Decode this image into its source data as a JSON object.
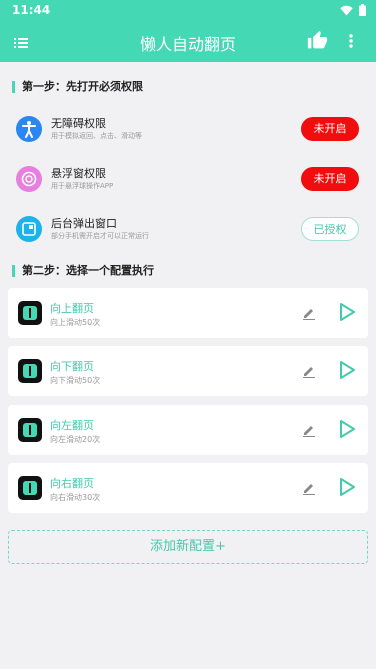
{
  "status": {
    "time": "11:44"
  },
  "appbar": {
    "title": "懒人自动翻页"
  },
  "step1": {
    "title": "第一步：先打开必须权限",
    "items": [
      {
        "title": "无障碍权限",
        "desc": "用于模拟返回、点击、滑动等",
        "button": "未开启",
        "icon": "accessibility-icon",
        "state": "off"
      },
      {
        "title": "悬浮窗权限",
        "desc": "用于悬浮球操作APP",
        "button": "未开启",
        "icon": "floating-window-icon",
        "state": "off"
      },
      {
        "title": "后台弹出窗口",
        "desc": "部分手机需开启才可以正常运行",
        "button": "已授权",
        "icon": "background-popup-icon",
        "state": "on"
      }
    ]
  },
  "step2": {
    "title": "第二步：选择一个配置执行",
    "configs": [
      {
        "title": "向上翻页",
        "desc": "向上滑动50次"
      },
      {
        "title": "向下翻页",
        "desc": "向下滑动50次"
      },
      {
        "title": "向左翻页",
        "desc": "向左滑动20次"
      },
      {
        "title": "向右翻页",
        "desc": "向右滑动30次"
      }
    ]
  },
  "add_button": "添加新配置+",
  "colors": {
    "accent": "#45d8b4",
    "danger": "#f10d0d",
    "background": "#f1f1f3"
  }
}
